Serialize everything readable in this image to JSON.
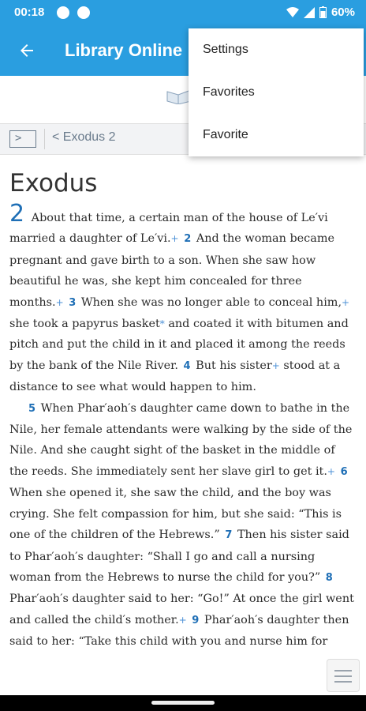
{
  "status_bar": {
    "time": "00:18",
    "battery": "60%"
  },
  "app_bar": {
    "title": "Library Online"
  },
  "nav": {
    "prev_chapter": "Exodus 2",
    "expand_glyph": ">",
    "prev_glyph": "<"
  },
  "menu": {
    "items": [
      "Settings",
      "Favorites",
      "Favorite"
    ]
  },
  "content": {
    "book_title": "Exodus",
    "chapter": "2",
    "ref_mark": "+",
    "star_mark": "*",
    "t1": "About that time, a certain man of the house of Le′vi married a daughter of Le′vi.",
    "v2": "2",
    "t2": "And the woman became pregnant and gave birth to a son. When she saw how beautiful he was, she kept him concealed for three months.",
    "v3": "3",
    "t3a": "When she was no longer able to conceal him,",
    "t3b": "she took a papyrus basket",
    "t3c": "and coated it with bitumen and pitch and put the child in it and placed it among the reeds by the bank of the Nile River.",
    "v4": "4",
    "t4a": "But his sister",
    "t4b": "stood at a distance to see what would happen to him.",
    "v5": "5",
    "t5": "When Phar′aoh′s daughter came down to bathe in the Nile, her female attendants were walking by the side of the Nile. And she caught sight of the basket in the middle of the reeds. She immediately sent her slave girl to get it.",
    "v6": "6",
    "t6": "When she opened it, she saw the child, and the boy was crying. She felt compassion for him, but she said: “This is one of the children of the Hebrews.”",
    "v7": "7",
    "t7": "Then his sister said to Phar′aoh′s daughter: “Shall I go and call a nursing woman from the Hebrews to nurse the child for you?”",
    "v8": "8",
    "t8": "Phar′aoh′s daughter said to her: “Go!” At once the girl went and called the child′s mother.",
    "v9": "9",
    "t9": "Phar′aoh′s daughter then said to her: “Take this child with you and nurse him for"
  },
  "colors": {
    "primary": "#2a9ee0",
    "verse_number": "#1f6fb6"
  }
}
